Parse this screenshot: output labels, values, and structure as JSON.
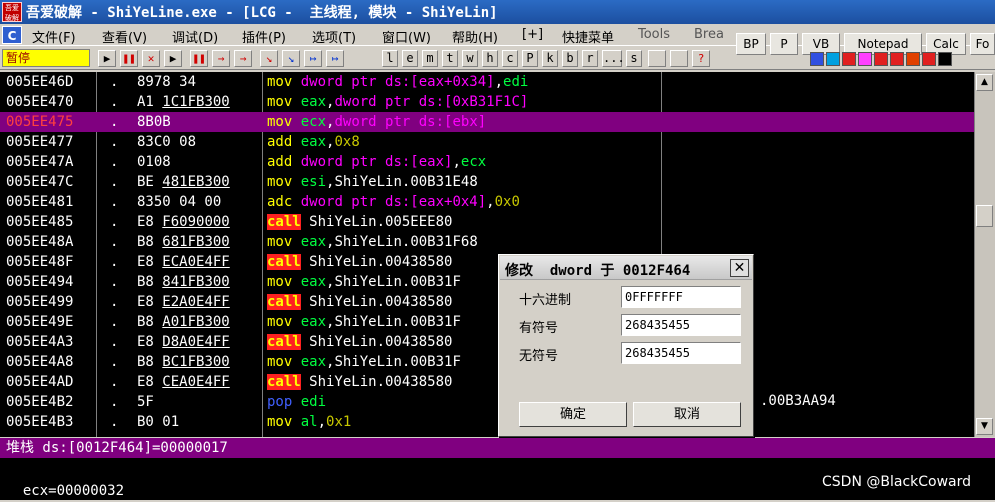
{
  "window": {
    "app_icon_text": "吾爱破解",
    "title": "吾爱破解 - ShiYeLine.exe - [LCG -  主线程, 模块 - ShiYeLin]"
  },
  "menu": {
    "icon_letter": "C",
    "items": [
      "文件(F)",
      "查看(V)",
      "调试(D)",
      "插件(P)",
      "选项(T)",
      "窗口(W)",
      "帮助(H)",
      "[+]",
      "快捷菜单",
      "Tools",
      "Brea"
    ],
    "right_buttons": [
      "BP",
      "P",
      "VB",
      "Notepad",
      "Calc",
      "Fo"
    ]
  },
  "toolbar": {
    "status": "暂停",
    "letter_buttons": [
      "l",
      "e",
      "m",
      "t",
      "w",
      "h",
      "c",
      "P",
      "k",
      "b",
      "r",
      "...",
      "s"
    ],
    "transport_glyphs": [
      "▶",
      "❚❚",
      "✕",
      "▶",
      "❚❚",
      "→",
      "→",
      "↘",
      "↘",
      "↦",
      "↦"
    ],
    "help_glyph": "?"
  },
  "code": {
    "rows": [
      {
        "addr": "005EE46D",
        "dot": ".",
        "hex": "8978 34",
        "mn": "mov",
        "ops": [
          [
            "dword ptr ds:[eax+0x34]",
            "kw"
          ],
          [
            ",",
            "wh"
          ],
          [
            "edi",
            "gr"
          ]
        ]
      },
      {
        "addr": "005EE470",
        "dot": ".",
        "hex": "A1 1C1FB300",
        "mn": "mov",
        "ops": [
          [
            "eax",
            "gr"
          ],
          [
            ",",
            "wh"
          ],
          [
            "dword ptr ds:[0xB31F1C]",
            "kw"
          ]
        ]
      },
      {
        "addr": "005EE475",
        "dot": ".",
        "hex": "8B0B",
        "mn": "mov",
        "sel": true,
        "ops": [
          [
            "ecx",
            "gr"
          ],
          [
            ",",
            "wh"
          ],
          [
            "dword ptr ds:[ebx]",
            "kw"
          ]
        ]
      },
      {
        "addr": "005EE477",
        "dot": ".",
        "hex": "83C0 08",
        "mn": "add",
        "ops": [
          [
            "eax",
            "gr"
          ],
          [
            ",",
            "wh"
          ],
          [
            "0x8",
            "ol"
          ]
        ]
      },
      {
        "addr": "005EE47A",
        "dot": ".",
        "hex": "0108",
        "mn": "add",
        "ops": [
          [
            "dword ptr ds:[eax]",
            "kw"
          ],
          [
            ",",
            "wh"
          ],
          [
            "ecx",
            "gr"
          ]
        ]
      },
      {
        "addr": "005EE47C",
        "dot": ".",
        "hex": "BE 481EB300",
        "mn": "mov",
        "ops": [
          [
            "esi",
            "gr"
          ],
          [
            ",ShiYeLin.00B31E48",
            "wh"
          ]
        ]
      },
      {
        "addr": "005EE481",
        "dot": ".",
        "hex": "8350 04 00",
        "mn": "adc",
        "ops": [
          [
            "dword ptr ds:[eax+0x4]",
            "kw"
          ],
          [
            ",",
            "wh"
          ],
          [
            "0x0",
            "ol"
          ]
        ]
      },
      {
        "addr": "005EE485",
        "dot": ".",
        "hex": "E8 F6090000",
        "mn": "call",
        "ops": [
          [
            " ShiYeLin.005EEE80",
            "wh"
          ]
        ]
      },
      {
        "addr": "005EE48A",
        "dot": ".",
        "hex": "B8 681FB300",
        "mn": "mov",
        "ops": [
          [
            "eax",
            "gr"
          ],
          [
            ",ShiYeLin.00B31F68",
            "wh"
          ]
        ]
      },
      {
        "addr": "005EE48F",
        "dot": ".",
        "hex": "E8 ECA0E4FF",
        "mn": "call",
        "ops": [
          [
            " ShiYeLin.00438580",
            "wh"
          ]
        ]
      },
      {
        "addr": "005EE494",
        "dot": ".",
        "hex": "B8 841FB300",
        "mn": "mov",
        "ops": [
          [
            "eax",
            "gr"
          ],
          [
            ",ShiYeLin.00B31F",
            "wh"
          ]
        ]
      },
      {
        "addr": "005EE499",
        "dot": ".",
        "hex": "E8 E2A0E4FF",
        "mn": "call",
        "ops": [
          [
            " ShiYeLin.00438580",
            "wh"
          ]
        ]
      },
      {
        "addr": "005EE49E",
        "dot": ".",
        "hex": "B8 A01FB300",
        "mn": "mov",
        "ops": [
          [
            "eax",
            "gr"
          ],
          [
            ",ShiYeLin.00B31F",
            "wh"
          ]
        ]
      },
      {
        "addr": "005EE4A3",
        "dot": ".",
        "hex": "E8 D8A0E4FF",
        "mn": "call",
        "ops": [
          [
            " ShiYeLin.00438580",
            "wh"
          ]
        ]
      },
      {
        "addr": "005EE4A8",
        "dot": ".",
        "hex": "B8 BC1FB300",
        "mn": "mov",
        "ops": [
          [
            "eax",
            "gr"
          ],
          [
            ",ShiYeLin.00B31F",
            "wh"
          ]
        ]
      },
      {
        "addr": "005EE4AD",
        "dot": ".",
        "hex": "E8 CEA0E4FF",
        "mn": "call",
        "ops": [
          [
            " ShiYeLin.00438580",
            "wh"
          ]
        ]
      },
      {
        "addr": "005EE4B2",
        "dot": ".",
        "hex": "5F",
        "mn": "pop",
        "ops": [
          [
            " edi",
            "gr"
          ]
        ]
      },
      {
        "addr": "005EE4B3",
        "dot": ".",
        "hex": "B0 01",
        "mn": "mov",
        "ops": [
          [
            "al",
            "gr"
          ],
          [
            ",",
            "wh"
          ],
          [
            "0x1",
            "ol"
          ]
        ]
      }
    ],
    "behind_dialog_text": ".00B3AA94"
  },
  "info": {
    "header": "堆栈 ds:[0012F464]=00000017",
    "line1": "ecx=00000032"
  },
  "dialog": {
    "title": "修改  dword 于 0012F464",
    "close": "✕",
    "fields": [
      {
        "label": "十六进制",
        "value": "0FFFFFFF"
      },
      {
        "label": "有符号",
        "value": "268435455"
      },
      {
        "label": "无符号",
        "value": "268435455"
      }
    ],
    "ok": "确定",
    "cancel": "取消"
  },
  "watermark": "CSDN @BlackCoward",
  "colors": {
    "selected_row": "#800080",
    "mnemonic": "#ffff00",
    "memory_operand": "#ff00ff",
    "register": "#00ff40",
    "call_highlight": "#ff2020"
  }
}
